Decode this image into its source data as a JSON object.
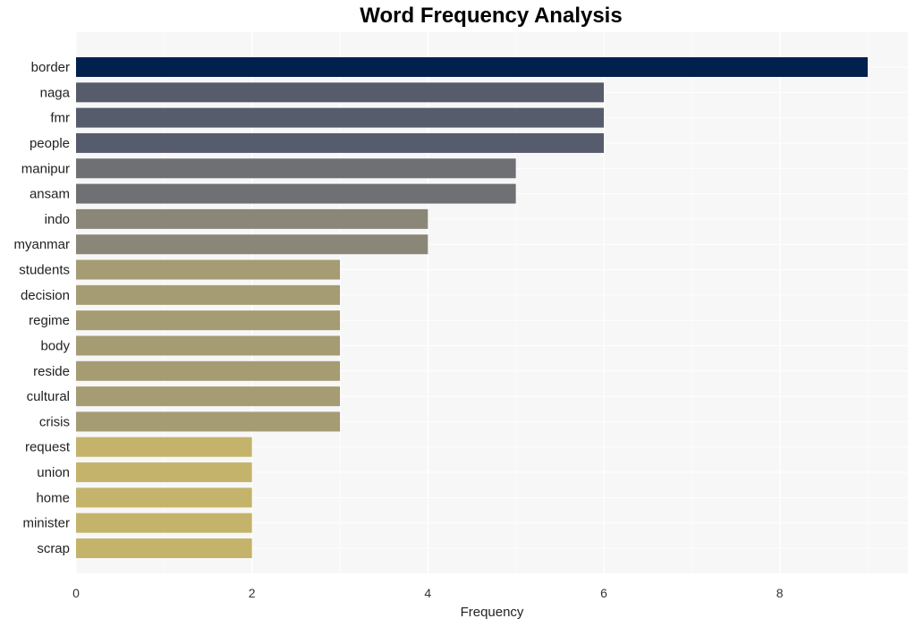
{
  "chart_data": {
    "type": "bar",
    "orientation": "horizontal",
    "title": "Word Frequency Analysis",
    "xlabel": "Frequency",
    "ylabel": "",
    "xlim": [
      0,
      9.45
    ],
    "xticks": [
      0,
      2,
      4,
      6,
      8
    ],
    "grid": true,
    "categories": [
      "border",
      "naga",
      "fmr",
      "people",
      "manipur",
      "ansam",
      "indo",
      "myanmar",
      "students",
      "decision",
      "regime",
      "body",
      "reside",
      "cultural",
      "crisis",
      "request",
      "union",
      "home",
      "minister",
      "scrap"
    ],
    "values": [
      9,
      6,
      6,
      6,
      5,
      5,
      4,
      4,
      3,
      3,
      3,
      3,
      3,
      3,
      3,
      2,
      2,
      2,
      2,
      2
    ],
    "colors": {
      "9": "#00204e",
      "6": "#575c6d",
      "5": "#6f7073",
      "4": "#8a8778",
      "3": "#a59c74",
      "2": "#c4b36a"
    },
    "background": "#f7f7f7"
  }
}
